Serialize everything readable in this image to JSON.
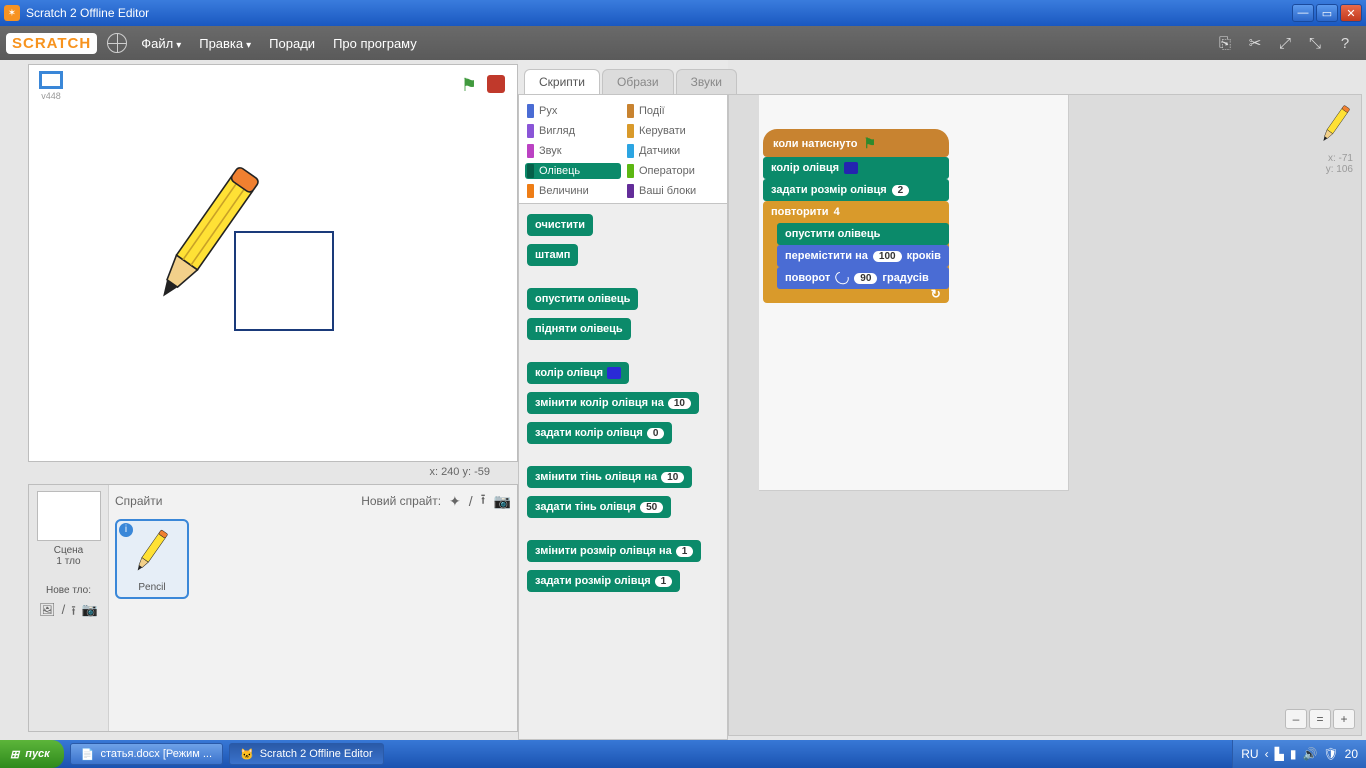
{
  "window": {
    "title": "Scratch 2 Offline Editor"
  },
  "menu": {
    "logo": "SCRATCH",
    "file": "Файл",
    "edit": "Правка",
    "tips": "Поради",
    "about": "Про програму"
  },
  "stage": {
    "version": "v448",
    "readout": "x: 240   y: -59"
  },
  "scene": {
    "title": "Сцена",
    "bg_line": "1 тло",
    "newbg": "Нове тло:"
  },
  "sprites": {
    "title": "Спрайти",
    "new_label": "Новий спрайт:",
    "item": "Pencil"
  },
  "tabs": {
    "scripts": "Скрипти",
    "costumes": "Образи",
    "sounds": "Звуки"
  },
  "categories": {
    "motion": "Рух",
    "events": "Події",
    "looks": "Вигляд",
    "control": "Керувати",
    "sound": "Звук",
    "sensing": "Датчики",
    "pen": "Олівець",
    "operators": "Оператори",
    "data": "Величини",
    "more": "Ваші блоки"
  },
  "palette": {
    "clear": "очистити",
    "stamp": "штамп",
    "pendown": "опустити олівець",
    "penup": "підняти олівець",
    "pencolor": "колір олівця",
    "changecolorby": "змінити колір олівця на",
    "setcolorto": "задати колір олівця",
    "changeshadeby": "змінити тінь олівця на",
    "setshadeto": "задати тінь олівця",
    "changesizeby": "змінити розмір олівця на",
    "setsizeto": "задати розмір олівця",
    "v10": "10",
    "v0": "0",
    "v50": "50",
    "v1": "1"
  },
  "script": {
    "hat": "коли натиснуто",
    "pencolor": "колір олівця",
    "setsize": "задати розмір олівця",
    "setsize_v": "2",
    "repeat": "повторити",
    "repeat_v": "4",
    "pendown": "опустити олівець",
    "move": "перемістити на",
    "move_v": "100",
    "move_sfx": "кроків",
    "turn": "поворот",
    "turn_v": "90",
    "turn_sfx": "градусів"
  },
  "coords": {
    "x": "x: -71",
    "y": "y: 106"
  },
  "taskbar": {
    "start": "пуск",
    "task1": "статья.docx [Режим ...",
    "task2": "Scratch 2 Offline Editor",
    "lang": "RU",
    "time": "20"
  }
}
